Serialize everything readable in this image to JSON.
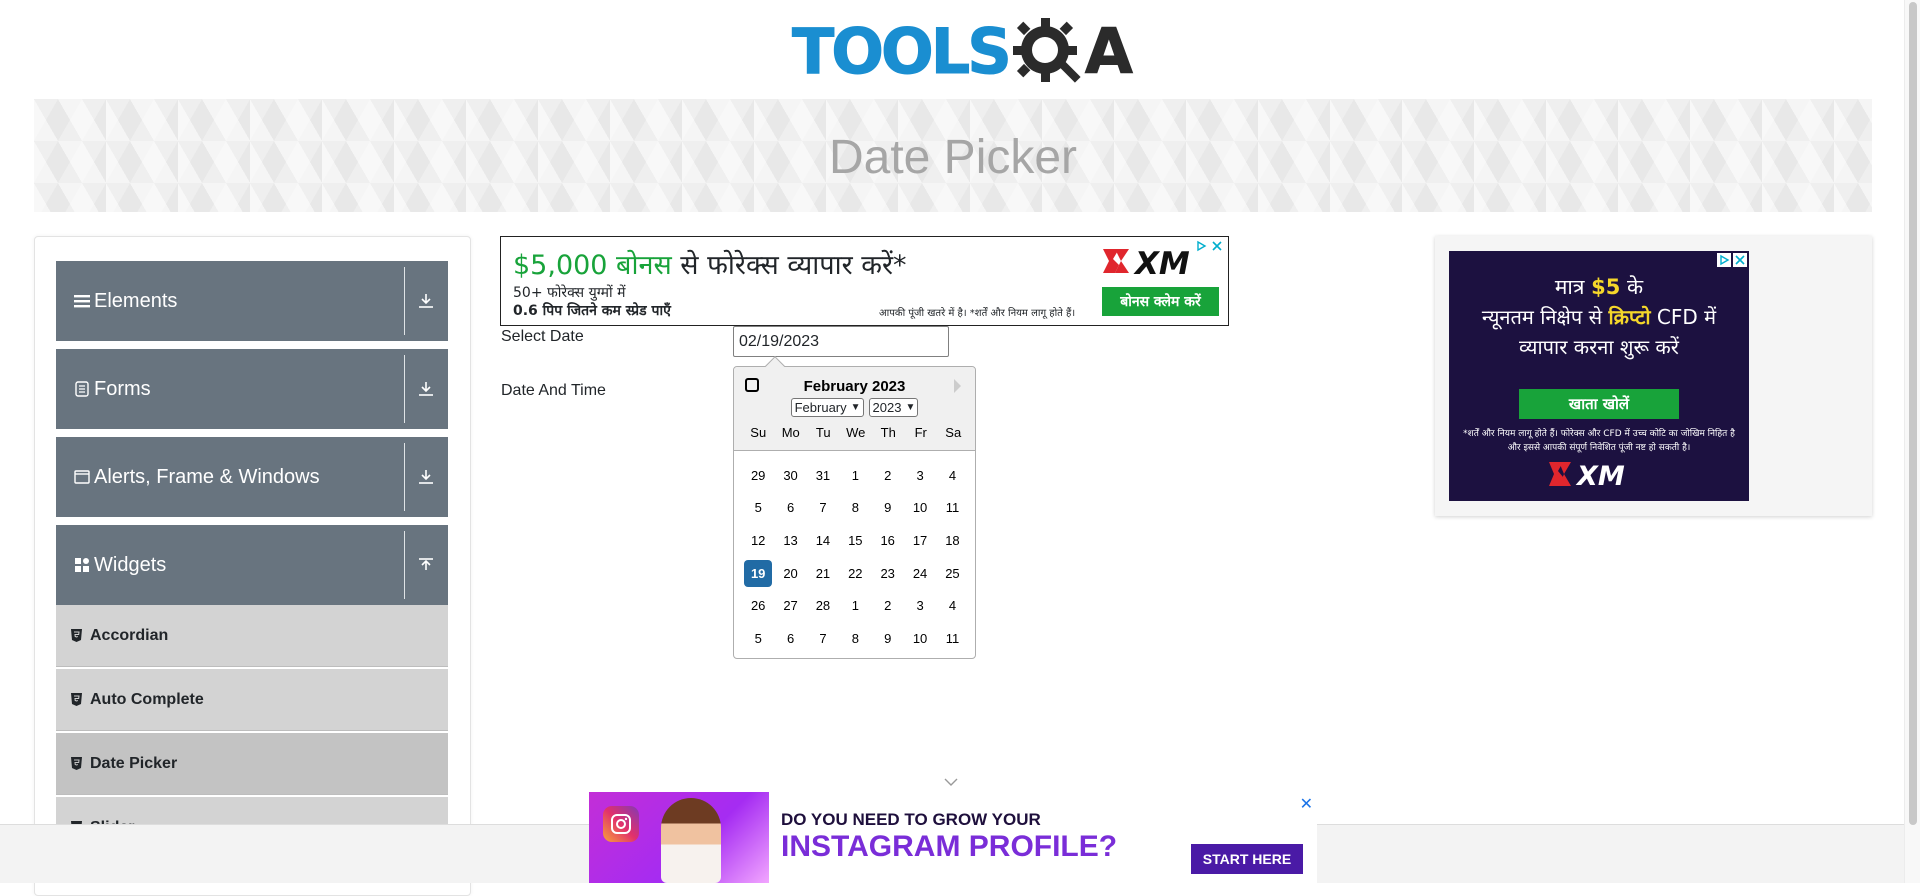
{
  "logo": {
    "part1": "TOOLS",
    "part2": "A"
  },
  "banner": {
    "title": "Date Picker"
  },
  "sidebar": {
    "groups": [
      {
        "label": "Elements",
        "toggle_icon": "download-icon"
      },
      {
        "label": "Forms",
        "toggle_icon": "download-icon"
      },
      {
        "label": "Alerts, Frame & Windows",
        "toggle_icon": "download-icon"
      },
      {
        "label": "Widgets",
        "toggle_icon": "upload-icon"
      }
    ],
    "widget_items": [
      {
        "label": "Accordian"
      },
      {
        "label": "Auto Complete"
      },
      {
        "label": "Date Picker"
      }
    ],
    "next_item_label": "Slider"
  },
  "ad_top": {
    "headline_green": "$5,000 बोनस",
    "headline_rest": " से फोरेक्स व्यापार करें*",
    "sub1": "50+ फोरेक्स युग्मों में",
    "sub2": "0.6 पिप जितने कम स्प्रेड पाएँ",
    "disclaimer": "आपकी पूंजी खतरे में है। *शर्तें और नियम लागू होते हैं।",
    "cta": "बोनस क्लेम करें",
    "brand": "XM"
  },
  "form": {
    "select_date_label": "Select Date",
    "select_date_value": "02/19/2023",
    "date_time_label": "Date And Time"
  },
  "calendar": {
    "title": "February 2023",
    "month_select": "February",
    "year_select": "2023",
    "weekdays": [
      "Su",
      "Mo",
      "Tu",
      "We",
      "Th",
      "Fr",
      "Sa"
    ],
    "weeks": [
      [
        "29",
        "30",
        "31",
        "1",
        "2",
        "3",
        "4"
      ],
      [
        "5",
        "6",
        "7",
        "8",
        "9",
        "10",
        "11"
      ],
      [
        "12",
        "13",
        "14",
        "15",
        "16",
        "17",
        "18"
      ],
      [
        "19",
        "20",
        "21",
        "22",
        "23",
        "24",
        "25"
      ],
      [
        "26",
        "27",
        "28",
        "1",
        "2",
        "3",
        "4"
      ],
      [
        "5",
        "6",
        "7",
        "8",
        "9",
        "10",
        "11"
      ]
    ],
    "selected_day": "19"
  },
  "ad_right": {
    "line1_pre": "मात्र ",
    "line1_highlight": "$5",
    "line1_post": " के",
    "line2_pre": "न्यूनतम निक्षेप से ",
    "line2_highlight": "क्रिप्टो",
    "line2_post": " CFD में",
    "line3": "व्यापार करना शुरू करें",
    "cta": "खाता खोलें",
    "disclaimer": "*शर्तें और नियम लागू होते हैं। फोरेक्स और CFD में उच्च कोटि का जोखिम निहित है और इससे आपकी संपूर्ण निवेशित पूंजी नष्ट हो सकती है।",
    "brand": "XM"
  },
  "ad_bottom": {
    "line1": "DO YOU NEED TO GROW YOUR",
    "line2": "INSTAGRAM PROFILE?",
    "cta": "START HERE"
  },
  "colors": {
    "sidebar_header": "#68747f",
    "calendar_selected": "#216ba5",
    "logo_blue": "#1a8ed1",
    "xm_green": "#18a33a"
  }
}
